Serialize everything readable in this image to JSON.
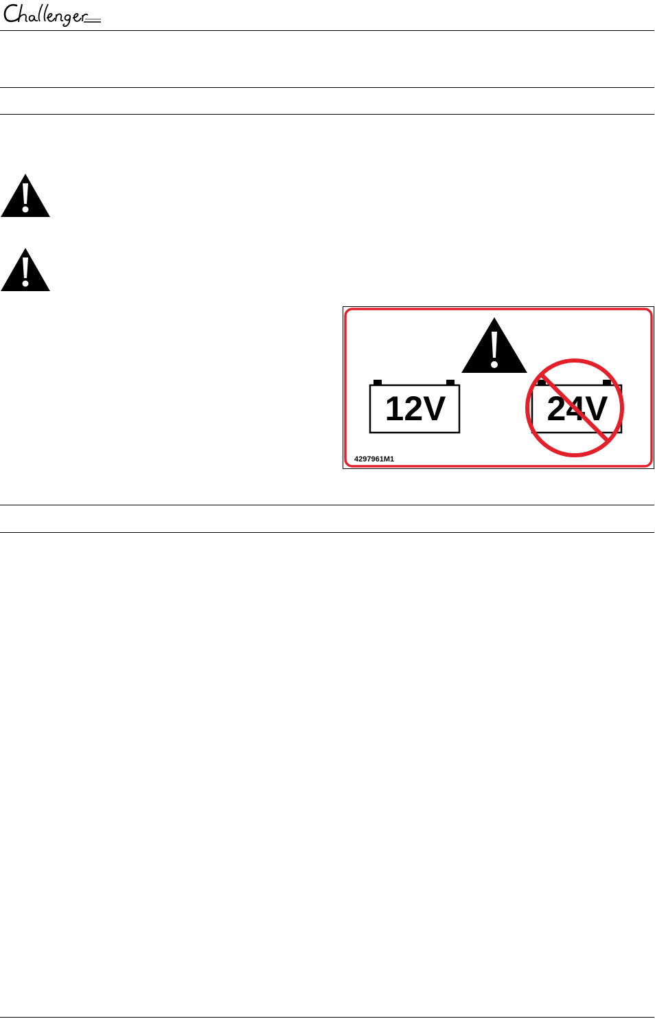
{
  "header": {
    "logo_text": "Challenger",
    "logo_icon": "challenger-script-logo"
  },
  "warnings": [
    {
      "icon": "warning-triangle-icon"
    },
    {
      "icon": "warning-triangle-icon"
    }
  ],
  "decal": {
    "part_number": "4297961M1",
    "allowed_voltage": "12V",
    "prohibited_voltage": "24V",
    "icons": [
      "warning-triangle-icon",
      "battery-icon",
      "prohibited-circle-icon"
    ],
    "colors": {
      "frame_red": "#e3202a",
      "prohibit_red": "#e3202a",
      "black": "#000000"
    }
  }
}
